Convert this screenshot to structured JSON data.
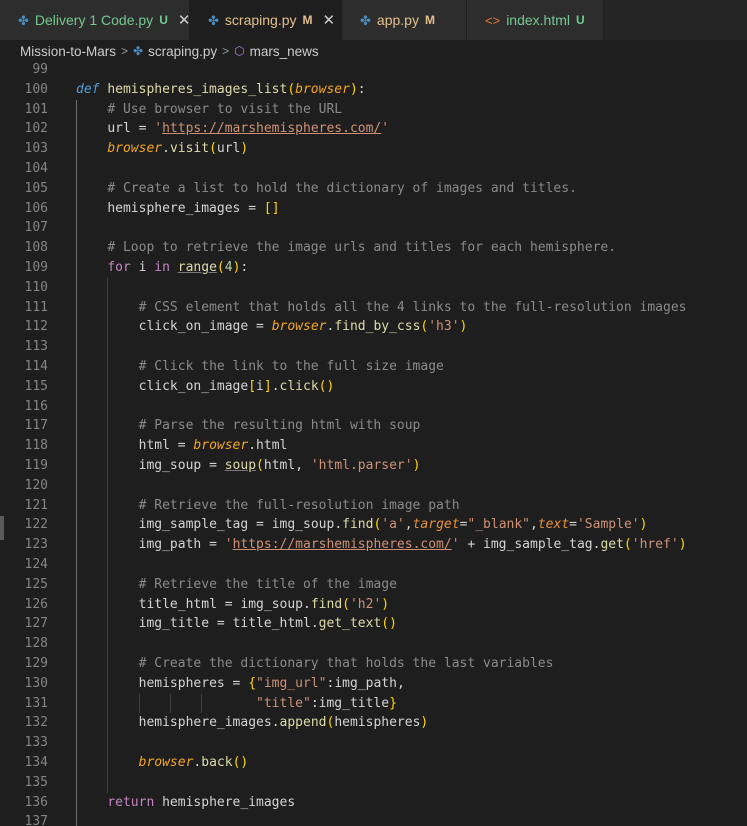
{
  "tabs": [
    {
      "name": "Delivery 1 Code.py",
      "status": "U",
      "icon": "python-file-icon",
      "active": false,
      "status_color": "#73c991",
      "closable": true
    },
    {
      "name": "scraping.py",
      "status": "M",
      "icon": "python-file-icon",
      "active": true,
      "status_color": "#e2c08d",
      "closable": true
    },
    {
      "name": "app.py",
      "status": "M",
      "icon": "python-file-icon",
      "active": false,
      "status_color": "#e2c08d",
      "closable": false
    },
    {
      "name": "index.html",
      "status": "U",
      "icon": "html-file-icon",
      "active": false,
      "status_color": "#73c991",
      "closable": false
    }
  ],
  "close_glyph": "✕",
  "breadcrumb": {
    "folder": "Mission-to-Mars",
    "file": "scraping.py",
    "symbol": "mars_news",
    "separator": ">"
  },
  "code": {
    "lines": [
      {
        "n": "99",
        "t": ""
      },
      {
        "n": "100",
        "t": "def hemispheres_images_list(browser):"
      },
      {
        "n": "101",
        "t": "    # Use browser to visit the URL"
      },
      {
        "n": "102",
        "t": "    url = 'https://marshemispheres.com/'"
      },
      {
        "n": "103",
        "t": "    browser.visit(url)"
      },
      {
        "n": "104",
        "t": ""
      },
      {
        "n": "105",
        "t": "    # Create a list to hold the dictionary of images and titles."
      },
      {
        "n": "106",
        "t": "    hemisphere_images = []"
      },
      {
        "n": "107",
        "t": ""
      },
      {
        "n": "108",
        "t": "    # Loop to retrieve the image urls and titles for each hemisphere."
      },
      {
        "n": "109",
        "t": "    for i in range(4):"
      },
      {
        "n": "110",
        "t": ""
      },
      {
        "n": "111",
        "t": "        # CSS element that holds all the 4 links to the full-resolution images"
      },
      {
        "n": "112",
        "t": "        click_on_image = browser.find_by_css('h3')"
      },
      {
        "n": "113",
        "t": ""
      },
      {
        "n": "114",
        "t": "        # Click the link to the full size image"
      },
      {
        "n": "115",
        "t": "        click_on_image[i].click()"
      },
      {
        "n": "116",
        "t": ""
      },
      {
        "n": "117",
        "t": "        # Parse the resulting html with soup"
      },
      {
        "n": "118",
        "t": "        html = browser.html"
      },
      {
        "n": "119",
        "t": "        img_soup = soup(html, 'html.parser')"
      },
      {
        "n": "120",
        "t": ""
      },
      {
        "n": "121",
        "t": "        # Retrieve the full-resolution image path"
      },
      {
        "n": "122",
        "t": "        img_sample_tag = img_soup.find('a',target=\"_blank\",text='Sample')"
      },
      {
        "n": "123",
        "t": "        img_path = 'https://marshemispheres.com/' + img_sample_tag.get('href')"
      },
      {
        "n": "124",
        "t": ""
      },
      {
        "n": "125",
        "t": "        # Retrieve the title of the image"
      },
      {
        "n": "126",
        "t": "        title_html = img_soup.find('h2')"
      },
      {
        "n": "127",
        "t": "        img_title = title_html.get_text()"
      },
      {
        "n": "128",
        "t": ""
      },
      {
        "n": "129",
        "t": "        # Create the dictionary that holds the last variables"
      },
      {
        "n": "130",
        "t": "        hemispheres = {\"img_url\":img_path,"
      },
      {
        "n": "131",
        "t": "                       \"title\":img_title}"
      },
      {
        "n": "132",
        "t": "        hemisphere_images.append(hemispheres)"
      },
      {
        "n": "133",
        "t": ""
      },
      {
        "n": "134",
        "t": "        browser.back()"
      },
      {
        "n": "135",
        "t": ""
      },
      {
        "n": "136",
        "t": "    return hemisphere_images"
      },
      {
        "n": "137",
        "t": ""
      }
    ]
  },
  "colors": {
    "editor_bg": "#1e1e1e",
    "tabbar_bg": "#252526",
    "tab_inactive": "#2d2d2d",
    "modified": "#e2c08d",
    "untracked": "#73c991"
  }
}
